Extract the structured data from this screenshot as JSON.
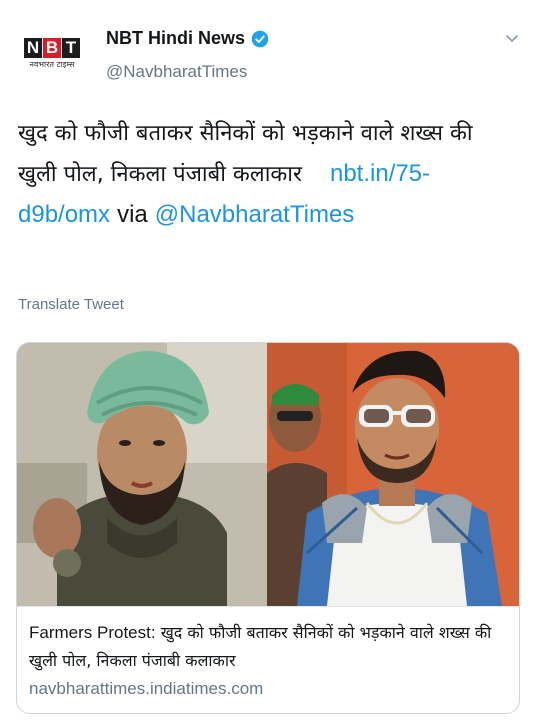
{
  "account": {
    "logo_text": "NBT",
    "logo_letters": [
      "N",
      "B",
      "T"
    ],
    "logo_subtext": "नवभारत टाइम्स",
    "name": "NBT Hindi News",
    "handle": "@NavbharatTimes",
    "verified_icon": "verified-badge-icon",
    "menu_icon": "chevron-down-icon"
  },
  "tweet": {
    "text": "खुद को फौजी बताकर सैनिकों को भड़काने वाले शख्स की खुली पोल, निकला पंजाबी कलाकार",
    "link": "nbt.in/75-d9b/omx",
    "via": "via",
    "mention": "@NavbharatTimes",
    "translate_label": "Translate Tweet"
  },
  "card": {
    "title_prefix": "Farmers Protest:",
    "title": "खुद को फौजी बताकर सैनिकों को भड़काने वाले शख्स की खुली पोल, निकला पंजाबी कलाकार",
    "domain": "navbharattimes.indiatimes.com"
  },
  "colors": {
    "link": "#1b95e0",
    "secondary_text": "#657786",
    "logo_red": "#d61f26",
    "border": "#ccd6dd"
  }
}
